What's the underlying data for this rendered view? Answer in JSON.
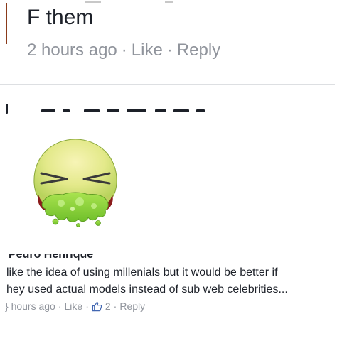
{
  "top_comment": {
    "text": "F them",
    "time": "2 hours ago",
    "like_label": "Like",
    "reply_label": "Reply",
    "separator": "·"
  },
  "sticker": {
    "icon": "vomiting-face-sticker-icon",
    "face_color": "#e6ea8c",
    "vomit_color": "#8fd63b"
  },
  "second_comment": {
    "author_cut": "Pedro Henrique",
    "line1": "like the idea of using millenials but it would be better if",
    "line2": "hey used actual models instead of sub web celebrities...",
    "time": "} hours ago",
    "like_label": "Like",
    "likes_count": "2",
    "reply_label": "Reply",
    "separator": "·"
  }
}
